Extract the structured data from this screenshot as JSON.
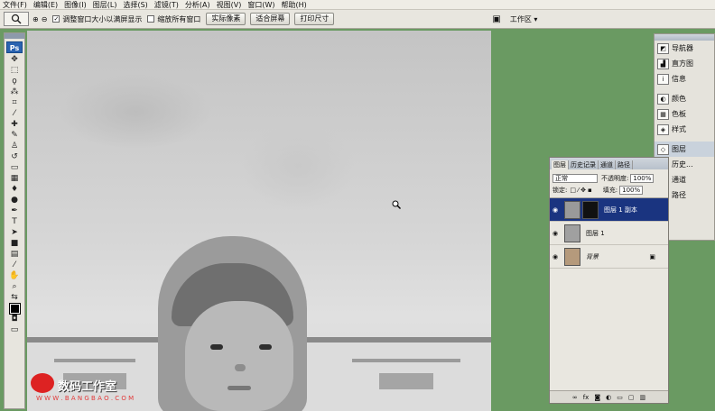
{
  "menu": [
    "文件(F)",
    "编辑(E)",
    "图像(I)",
    "图层(L)",
    "选择(S)",
    "滤镜(T)",
    "分析(A)",
    "视图(V)",
    "窗口(W)",
    "帮助(H)"
  ],
  "options": {
    "zoom_tool_icon": "magnifier-icon",
    "check_resize": "调整窗口大小以满屏显示",
    "check_all": "缩放所有窗口",
    "btn_actual": "实际像素",
    "btn_fit": "适合屏幕",
    "btn_print": "打印尺寸",
    "workspace": "工作区 ▾"
  },
  "toolbox": {
    "logo": "Ps"
  },
  "watermark": {
    "text": "数码工作室",
    "url": "W W W . B A N G B A O . C O M"
  },
  "dock": {
    "items": [
      "导航器",
      "直方图",
      "信息",
      "颜色",
      "色板",
      "样式",
      "图层",
      "历史...",
      "通道",
      "路径"
    ]
  },
  "layers_panel": {
    "tabs": [
      "图层",
      "历史记录",
      "通道",
      "路径"
    ],
    "blend_mode": "正常",
    "opacity_label": "不透明度:",
    "opacity_value": "100%",
    "lock_label": "锁定:",
    "fill_label": "填充:",
    "fill_value": "100%",
    "layers": [
      {
        "name": "图层 1 副本",
        "selected": true
      },
      {
        "name": "图层 1",
        "selected": false
      },
      {
        "name": "背景",
        "selected": false,
        "locked": true
      }
    ],
    "footer_icons": [
      "link-icon",
      "fx-icon",
      "mask-icon",
      "adjustment-icon",
      "group-icon",
      "new-layer-icon",
      "trash-icon"
    ]
  },
  "colors": {
    "background": "#6a9a62",
    "selected_layer": "#1a3480"
  }
}
